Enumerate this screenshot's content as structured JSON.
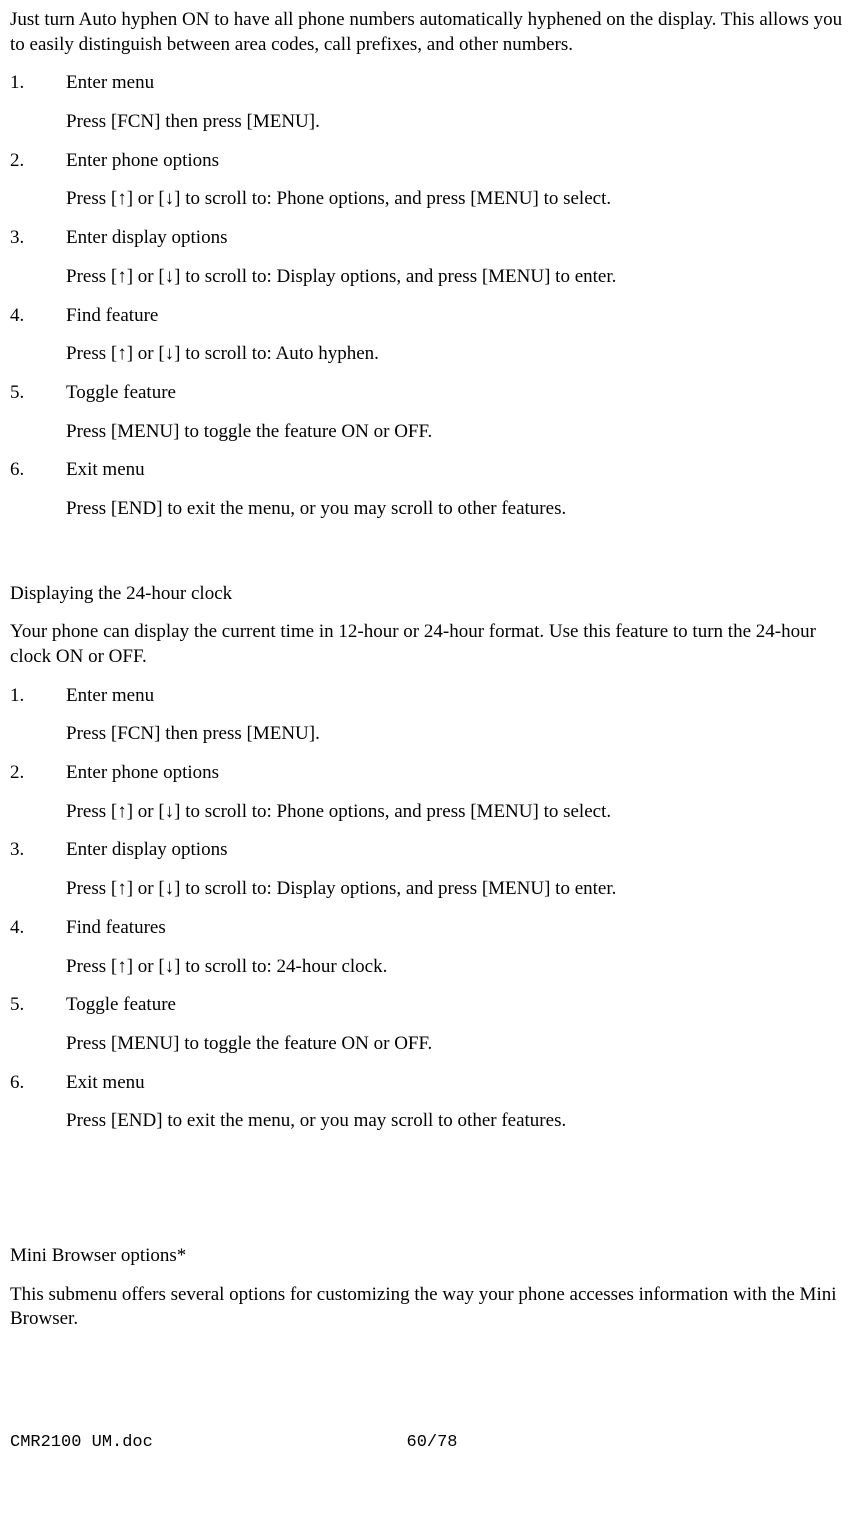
{
  "section1": {
    "intro": "Just turn Auto hyphen ON to have all phone numbers automatically hyphened on the display. This allows you to easily distinguish between area codes, call prefixes, and other numbers.",
    "steps": [
      {
        "num": "1.",
        "title": "Enter menu",
        "detail": "Press [FCN] then press [MENU]."
      },
      {
        "num": "2.",
        "title": "Enter phone options",
        "detail": "Press [↑] or [↓] to scroll to: Phone options, and press [MENU] to select."
      },
      {
        "num": "3.",
        "title": "Enter display options",
        "detail": "Press [↑] or [↓] to scroll to: Display options, and press [MENU] to enter."
      },
      {
        "num": "4.",
        "title": "Find feature",
        "detail": "Press [↑] or [↓] to scroll to: Auto hyphen."
      },
      {
        "num": "5.",
        "title": "Toggle feature",
        "detail": "Press [MENU] to toggle the feature ON or OFF."
      },
      {
        "num": "6.",
        "title": "Exit menu",
        "detail": "Press [END] to exit the menu, or you may scroll to other features."
      }
    ]
  },
  "section2": {
    "heading": "Displaying the 24-hour clock",
    "intro": "Your phone can display the current time in 12-hour or 24-hour format. Use this feature to turn the 24-hour clock ON or OFF.",
    "steps": [
      {
        "num": "1.",
        "title": "Enter menu",
        "detail": "Press [FCN] then press [MENU]."
      },
      {
        "num": "2.",
        "title": "Enter phone options",
        "detail": "Press [↑] or [↓] to scroll to: Phone options, and press [MENU] to select."
      },
      {
        "num": "3.",
        "title": "Enter display options",
        "detail": "Press [↑] or [↓] to scroll to: Display options, and press [MENU] to enter."
      },
      {
        "num": "4.",
        "title": "Find features",
        "detail": "Press [↑] or [↓] to scroll to: 24-hour clock."
      },
      {
        "num": "5.",
        "title": "Toggle feature",
        "detail": "Press [MENU] to toggle the feature ON or OFF."
      },
      {
        "num": "6.",
        "title": "Exit menu",
        "detail": "Press [END] to exit the menu, or you may scroll to other features."
      }
    ]
  },
  "section3": {
    "heading": "Mini Browser options*",
    "intro": "This submenu offers several options for customizing the way your phone accesses information with the Mini Browser."
  },
  "footer": {
    "left": "CMR2100 UM.doc",
    "center": "60/78"
  }
}
